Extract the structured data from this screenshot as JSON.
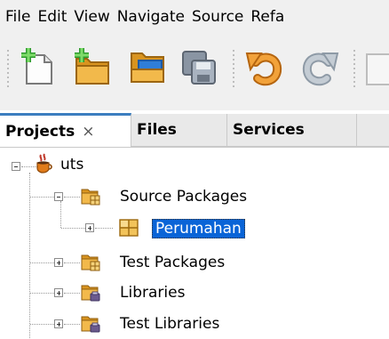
{
  "menubar": {
    "items": [
      "File",
      "Edit",
      "View",
      "Navigate",
      "Source",
      "Refa"
    ]
  },
  "toolbar": {
    "buttons": [
      {
        "icon": "new-file-icon"
      },
      {
        "icon": "new-project-icon"
      },
      {
        "icon": "open-project-icon"
      },
      {
        "icon": "save-all-icon"
      },
      {
        "icon": "undo-icon"
      },
      {
        "icon": "redo-icon"
      }
    ]
  },
  "tabs": [
    {
      "label": "Projects",
      "close": "×",
      "active": true
    },
    {
      "label": "Files",
      "active": false
    },
    {
      "label": "Services",
      "active": false
    }
  ],
  "tree": {
    "root": {
      "label": "uts",
      "icon": "coffee-cup-icon"
    },
    "nodes": [
      {
        "label": "Source Packages",
        "icon": "package-folder-icon",
        "expanded": true
      },
      {
        "label": "Perumahan",
        "icon": "package-icon",
        "selected": true
      },
      {
        "label": "Test Packages",
        "icon": "package-folder-icon",
        "expanded": false
      },
      {
        "label": "Libraries",
        "icon": "library-folder-icon",
        "expanded": false
      },
      {
        "label": "Test Libraries",
        "icon": "library-folder-icon",
        "expanded": false
      }
    ]
  },
  "colors": {
    "selection": "#0a64d7",
    "active_tab_accent": "#3c7ebf",
    "folder": "#e8b84a",
    "package": "#f0c35a"
  }
}
